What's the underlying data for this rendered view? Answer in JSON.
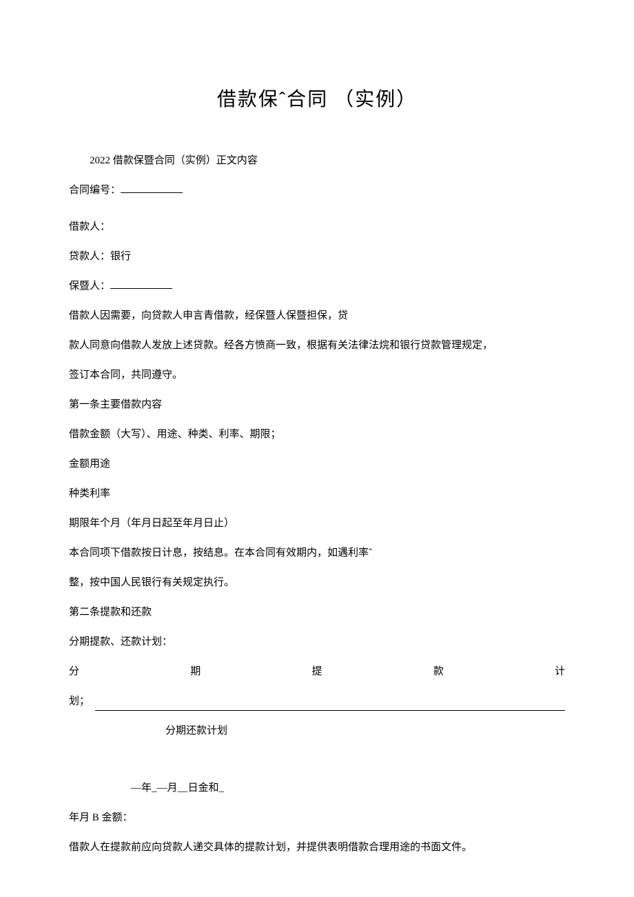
{
  "title": "借款保ˆ合同 （实例）",
  "intro": "2022 借款保暨合同（实例）正文内容",
  "contract_number_label": "合同编号：",
  "borrower_label": "借款人：",
  "lender_label": "贷款人：银行",
  "guarantor_label": "保暨人：",
  "preamble_1": "借款人因需要，向贷款人申言青借款，经保暨人保暨担保，贷",
  "preamble_2": "款人同意向借款人发放上述贷款。经各方愤商一致，根据有关法律法烷和银行贷款管理规定，",
  "preamble_3": "签订本合同，共同遵守。",
  "article1_title": "第一条主要借款内容",
  "article1_line1": "借款金额（大写）、用途、种类、利率、期限；",
  "article1_line2": "金额用途",
  "article1_line3": "种类利率",
  "article1_line4": "期限年个月（年月日起至年月日止）",
  "article1_line5": "本合同项下借款按日计息，按结息。在本合同有效期内，如遇利率ˆ",
  "article1_line6": "整，按中国人民银行有关规定执行。",
  "article2_title": "第二条提款和还款",
  "article2_line1": "分期提款、还款计划：",
  "justify_chars": {
    "c1": "分",
    "c2": "期",
    "c3": "提",
    "c4": "款",
    "c5": "计"
  },
  "plan_label": "划；",
  "repay_plan": "分期还款计划",
  "date_line": "—年_—月__日金和_",
  "amount_line": "年月 B 金额：",
  "final_line": "借款人在提款前应向贷款人递交具体的提款计划，并提供表明借款合理用途的书面文件。"
}
